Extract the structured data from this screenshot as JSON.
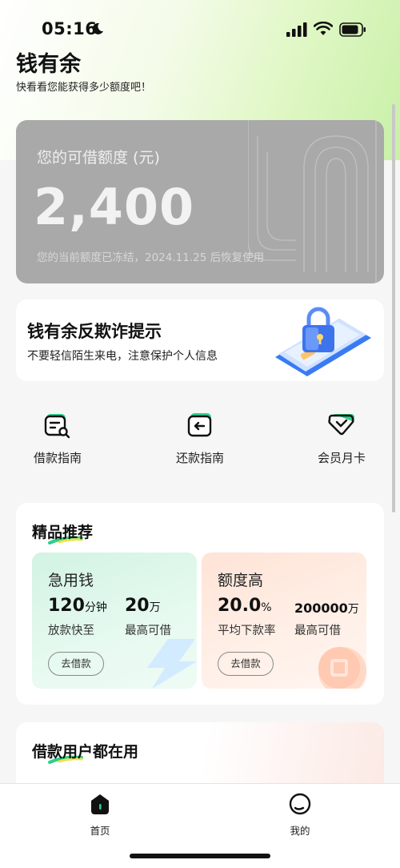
{
  "status_bar": {
    "time": "05:16"
  },
  "header": {
    "title": "钱有余",
    "subtitle": "快看看您能获得多少额度吧！"
  },
  "credit": {
    "label": "您的可借额度 (元)",
    "amount": "2,400",
    "note": "您的当前额度已冻结，2024.11.25 后恢复使用"
  },
  "fraud_banner": {
    "title": "钱有余反欺诈提示",
    "subtitle": "不要轻信陌生来电，注意保护个人信息"
  },
  "quick_actions": [
    {
      "label": "借款指南",
      "icon": "loan-guide-icon"
    },
    {
      "label": "还款指南",
      "icon": "repay-guide-icon"
    },
    {
      "label": "会员月卡",
      "icon": "membership-card-icon"
    }
  ],
  "recommend": {
    "title": "精品推荐",
    "products": [
      {
        "name": "急用钱",
        "value1": "120",
        "unit1": "分钟",
        "value2": "20",
        "unit2": "万",
        "caption1": "放款快至",
        "caption2": "最高可借",
        "button": "去借款"
      },
      {
        "name": "额度高",
        "value1": "20.0",
        "unit1": "%",
        "value2": "200000",
        "unit2": "万",
        "caption1": "平均下款率",
        "caption2": "最高可借",
        "button": "去借款"
      }
    ]
  },
  "users_section": {
    "title": "借款用户都在用"
  },
  "tab_bar": {
    "home": "首页",
    "mine": "我的"
  },
  "colors": {
    "accent_green": "#22c27a",
    "card_gray": "#a8a9a8"
  }
}
